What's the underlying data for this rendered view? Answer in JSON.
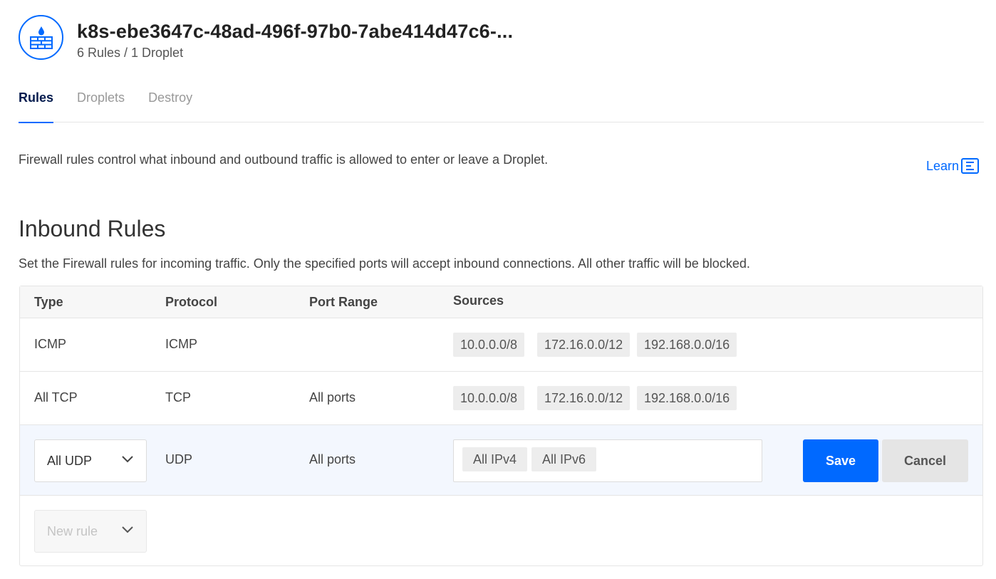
{
  "header": {
    "title": "k8s-ebe3647c-48ad-496f-97b0-7abe414d47c6-...",
    "subtitle": "6 Rules / 1 Droplet",
    "icon": "firewall-icon"
  },
  "tabs": [
    {
      "label": "Rules",
      "active": true
    },
    {
      "label": "Droplets",
      "active": false
    },
    {
      "label": "Destroy",
      "active": false
    }
  ],
  "intro": "Firewall rules control what inbound and outbound traffic is allowed to enter or leave a Droplet.",
  "learn": {
    "label": "Learn",
    "icon": "doc-icon"
  },
  "inbound": {
    "title": "Inbound Rules",
    "description": "Set the Firewall rules for incoming traffic. Only the specified ports will accept inbound connections. All other traffic will be blocked.",
    "columns": [
      "Type",
      "Protocol",
      "Port Range",
      "Sources"
    ],
    "rows": [
      {
        "type": "ICMP",
        "protocol": "ICMP",
        "port_range": "",
        "sources": [
          "10.0.0.0/8",
          "172.16.0.0/12",
          "192.168.0.0/16"
        ]
      },
      {
        "type": "All TCP",
        "protocol": "TCP",
        "port_range": "All ports",
        "sources": [
          "10.0.0.0/8",
          "172.16.0.0/12",
          "192.168.0.0/16"
        ]
      }
    ],
    "edit_row": {
      "type": "All UDP",
      "protocol": "UDP",
      "port_range": "All ports",
      "sources": [
        "All IPv4",
        "All IPv6"
      ],
      "save_label": "Save",
      "cancel_label": "Cancel"
    },
    "new_rule_placeholder": "New rule"
  },
  "colors": {
    "accent": "#0069ff",
    "tab_active": "#031b4e",
    "edit_row_bg": "#f3f7fe"
  }
}
